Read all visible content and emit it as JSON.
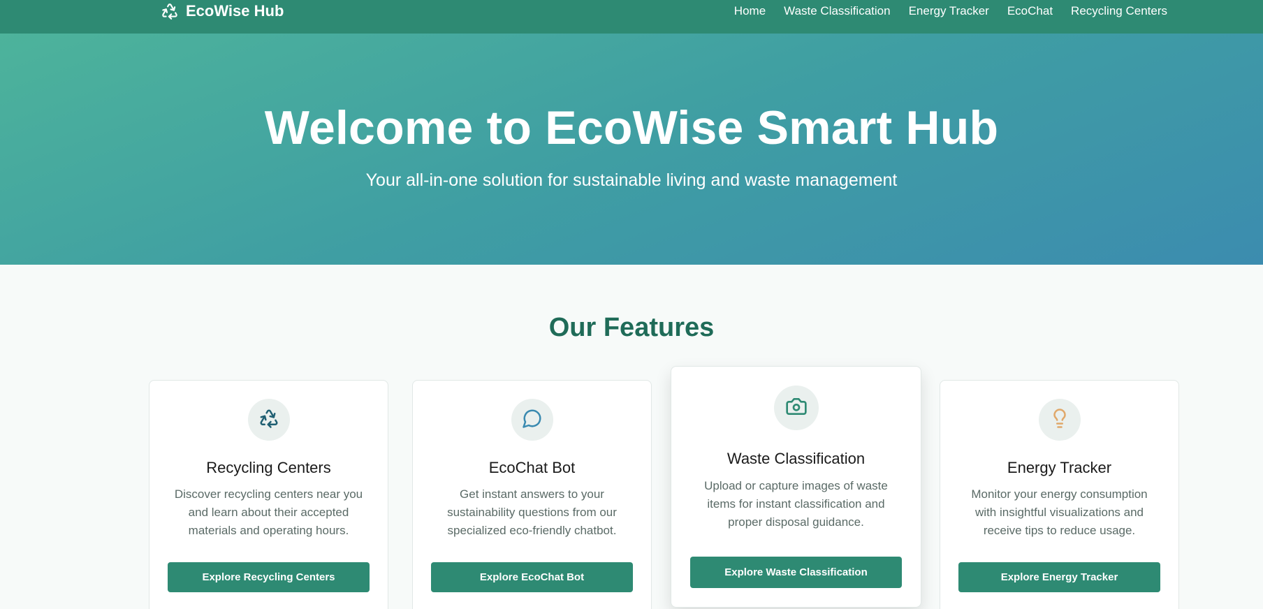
{
  "nav": {
    "brand": "EcoWise Hub",
    "brand_icon": "recycle-icon",
    "links": [
      "Home",
      "Waste Classification",
      "Energy Tracker",
      "EcoChat",
      "Recycling Centers"
    ]
  },
  "hero": {
    "title": "Welcome to EcoWise Smart Hub",
    "subtitle": "Your all-in-one solution for sustainable living and waste management"
  },
  "features": {
    "title": "Our Features",
    "cards": [
      {
        "title": "Recycling Centers",
        "icon": "recycle-icon",
        "description": "Discover recycling centers near you and learn about their accepted materials and operating hours.",
        "button": "Explore Recycling Centers"
      },
      {
        "title": "EcoChat Bot",
        "icon": "chat-bubble-icon",
        "description": "Get instant answers to your sustainability questions from our specialized eco-friendly chatbot.",
        "button": "Explore EcoChat Bot"
      },
      {
        "title": "Waste Classification",
        "icon": "camera-icon",
        "description": "Upload or capture images of waste items for instant classification and proper disposal guidance.",
        "button": "Explore Waste Classification"
      },
      {
        "title": "Energy Tracker",
        "icon": "lightbulb-icon",
        "description": "Monitor your energy consumption with insightful visualizations and receive tips to reduce usage.",
        "button": "Explore Energy Tracker"
      }
    ]
  },
  "colors": {
    "primary": "#2e8a73",
    "heading": "#1f6b58",
    "recycle_icon": "#1f5f72",
    "chat_icon": "#3a8ab0",
    "camera_icon": "#2e8a73",
    "bulb_icon": "#e0a86a"
  }
}
